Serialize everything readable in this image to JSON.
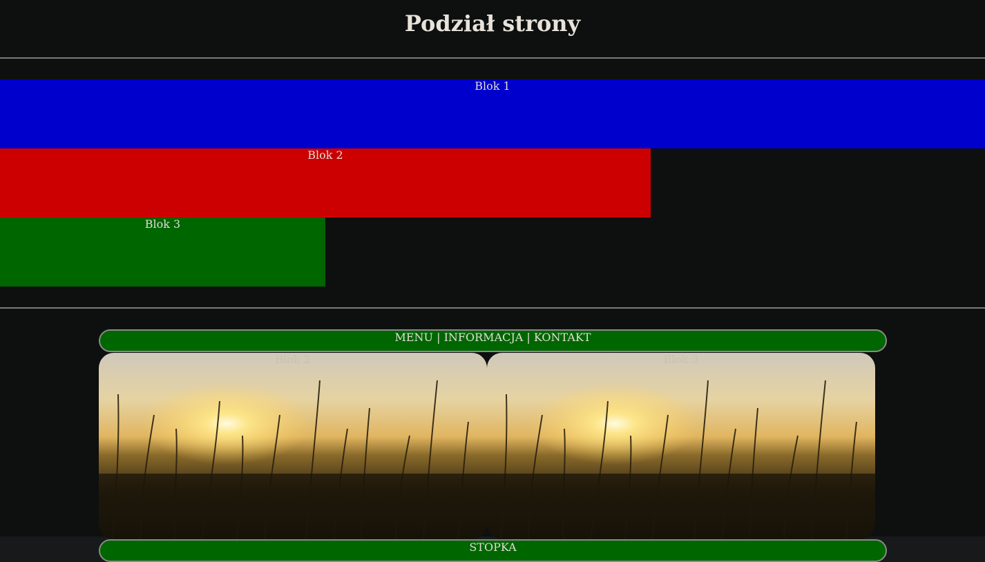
{
  "page": {
    "title": "Podział strony"
  },
  "colors": {
    "background": "#0e0f0f",
    "block1": "#0000cc",
    "block2": "#cc0000",
    "block3": "#006600",
    "nav_bg": "#006600",
    "footer_bg": "#006600"
  },
  "blocks": [
    {
      "label": "Blok 1"
    },
    {
      "label": "Blok 2"
    },
    {
      "label": "Blok 3"
    }
  ],
  "nav": {
    "items": [
      {
        "label": "MENU"
      },
      {
        "label": "INFORMACJA"
      },
      {
        "label": "KONTAKT"
      }
    ],
    "separator": "|"
  },
  "gallery": [
    {
      "label": "Blok 2",
      "image": "sunset-grass-photo"
    },
    {
      "label": "Blok 3",
      "image": "sunset-grass-photo"
    }
  ],
  "footer": {
    "label": "STOPKA"
  }
}
